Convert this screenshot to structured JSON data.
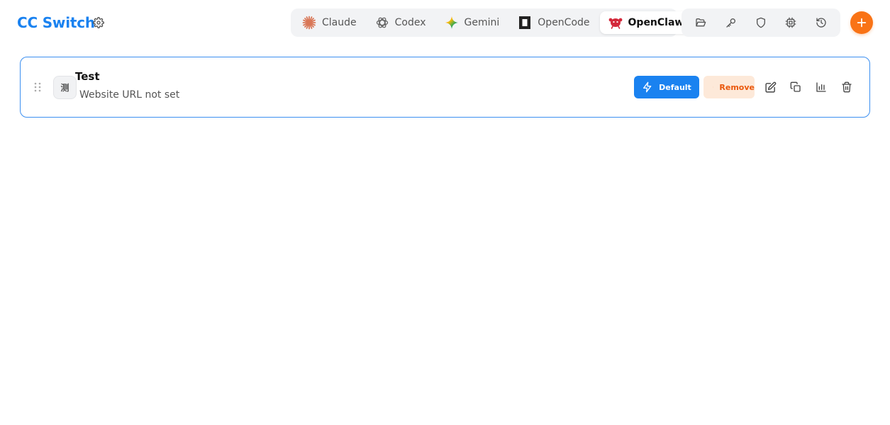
{
  "header": {
    "brand": "CC Switch",
    "settings_icon": "gear-icon"
  },
  "app_tabs": [
    {
      "label": "Claude",
      "icon": "claude-sunburst-icon",
      "color": "#d97757"
    },
    {
      "label": "Codex",
      "icon": "openai-knot-icon",
      "color": "#666666"
    },
    {
      "label": "Gemini",
      "icon": "gemini-sparkle-icon",
      "color": "#4285f4"
    },
    {
      "label": "OpenCode",
      "icon": "opencode-square-icon",
      "color": "#222222"
    },
    {
      "label": "OpenClaw",
      "icon": "openclaw-crab-icon",
      "color": "#d3283a",
      "active": true
    }
  ],
  "tools": [
    {
      "icon": "folder-open-icon"
    },
    {
      "icon": "key-icon"
    },
    {
      "icon": "shield-icon"
    },
    {
      "icon": "cpu-chip-icon"
    },
    {
      "icon": "history-icon"
    }
  ],
  "add_button": {
    "icon": "plus-icon",
    "color": "#f97316"
  },
  "provider": {
    "icon_text": "测",
    "name": "Test",
    "url": "Website URL not set",
    "default_label": "Default",
    "remove_label": "Remove",
    "actions": [
      {
        "icon": "edit-icon"
      },
      {
        "icon": "duplicate-icon"
      },
      {
        "icon": "bar-chart-icon"
      },
      {
        "icon": "trash-icon"
      }
    ]
  },
  "colors": {
    "accent": "#1a82f0",
    "orange": "#f97316",
    "remove_bg": "#fde9d9",
    "remove_text": "#ea580c"
  }
}
